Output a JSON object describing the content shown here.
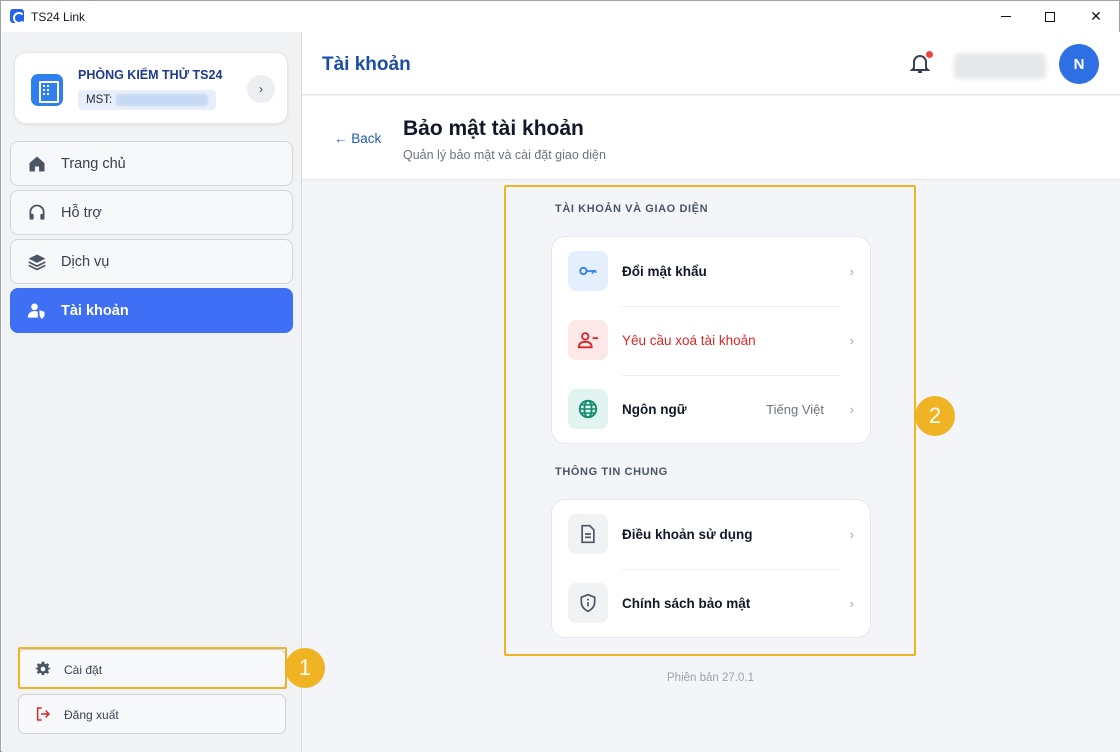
{
  "window": {
    "title": "TS24 Link"
  },
  "sidebar": {
    "org": {
      "name": "PHÒNG KIỂM THỬ TS24",
      "mst_label": "MST:"
    },
    "nav": [
      {
        "label": "Trang chủ",
        "icon": "home-icon",
        "active": false
      },
      {
        "label": "Hỗ trợ",
        "icon": "headset-icon",
        "active": false
      },
      {
        "label": "Dịch vụ",
        "icon": "layers-icon",
        "active": false
      },
      {
        "label": "Tài khoản",
        "icon": "user-shield-icon",
        "active": true
      }
    ],
    "settings_label": "Cài đặt",
    "logout_label": "Đăng xuất"
  },
  "header": {
    "title": "Tài khoản",
    "avatar_initial": "N"
  },
  "page": {
    "back_label": "← Back",
    "title": "Bảo mật tài khoản",
    "subtitle": "Quản lý bảo mật và cài đặt giao diện"
  },
  "groups": [
    {
      "label": "TÀI KHOẢN VÀ GIAO DIỆN",
      "rows": [
        {
          "label": "Đổi mật khẩu",
          "icon": "key-icon",
          "value": ""
        },
        {
          "label": "Yêu cầu xoá tài khoản",
          "icon": "user-remove-icon",
          "value": ""
        },
        {
          "label": "Ngôn ngữ",
          "icon": "globe-icon",
          "value": "Tiếng Việt"
        }
      ]
    },
    {
      "label": "THÔNG TIN CHUNG",
      "rows": [
        {
          "label": "Điều khoản sử dụng",
          "icon": "document-icon",
          "value": ""
        },
        {
          "label": "Chính sách bảo mật",
          "icon": "shield-info-icon",
          "value": ""
        }
      ]
    }
  ],
  "version": "Phiên bản 27.0.1",
  "annotations": {
    "badge_1": "1",
    "badge_2": "2"
  },
  "colors": {
    "accent": "#3f6ff5",
    "title_blue": "#1b4ea3",
    "highlight": "#f0b323",
    "danger": "#dc2626"
  }
}
